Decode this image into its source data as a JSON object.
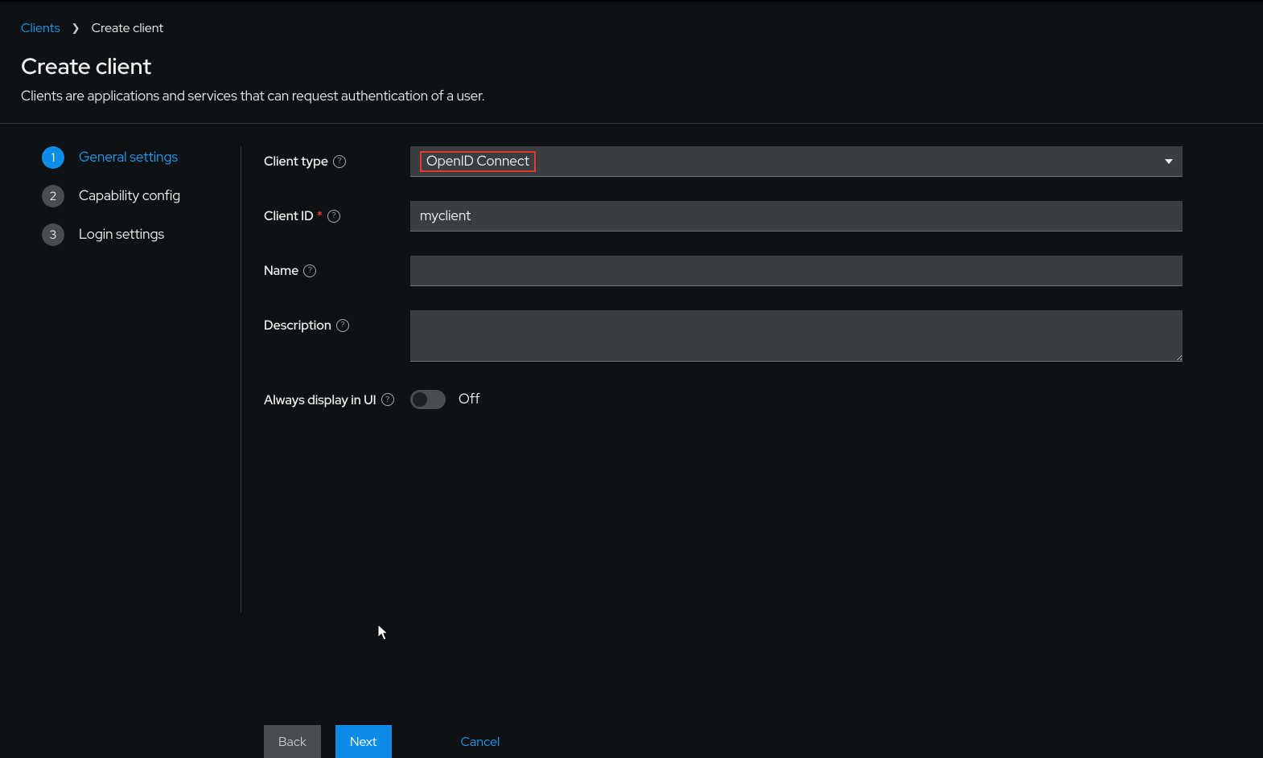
{
  "breadcrumb": {
    "parent": "Clients",
    "current": "Create client"
  },
  "header": {
    "title": "Create client",
    "description": "Clients are applications and services that can request authentication of a user."
  },
  "wizard": {
    "steps": [
      {
        "num": "1",
        "label": "General settings",
        "active": true
      },
      {
        "num": "2",
        "label": "Capability config",
        "active": false
      },
      {
        "num": "3",
        "label": "Login settings",
        "active": false
      }
    ]
  },
  "form": {
    "client_type": {
      "label": "Client type",
      "value": "OpenID Connect"
    },
    "client_id": {
      "label": "Client ID",
      "value": "myclient"
    },
    "name": {
      "label": "Name",
      "value": ""
    },
    "description": {
      "label": "Description",
      "value": ""
    },
    "always_display": {
      "label": "Always display in UI",
      "state_label": "Off"
    }
  },
  "buttons": {
    "back": "Back",
    "next": "Next",
    "cancel": "Cancel"
  }
}
